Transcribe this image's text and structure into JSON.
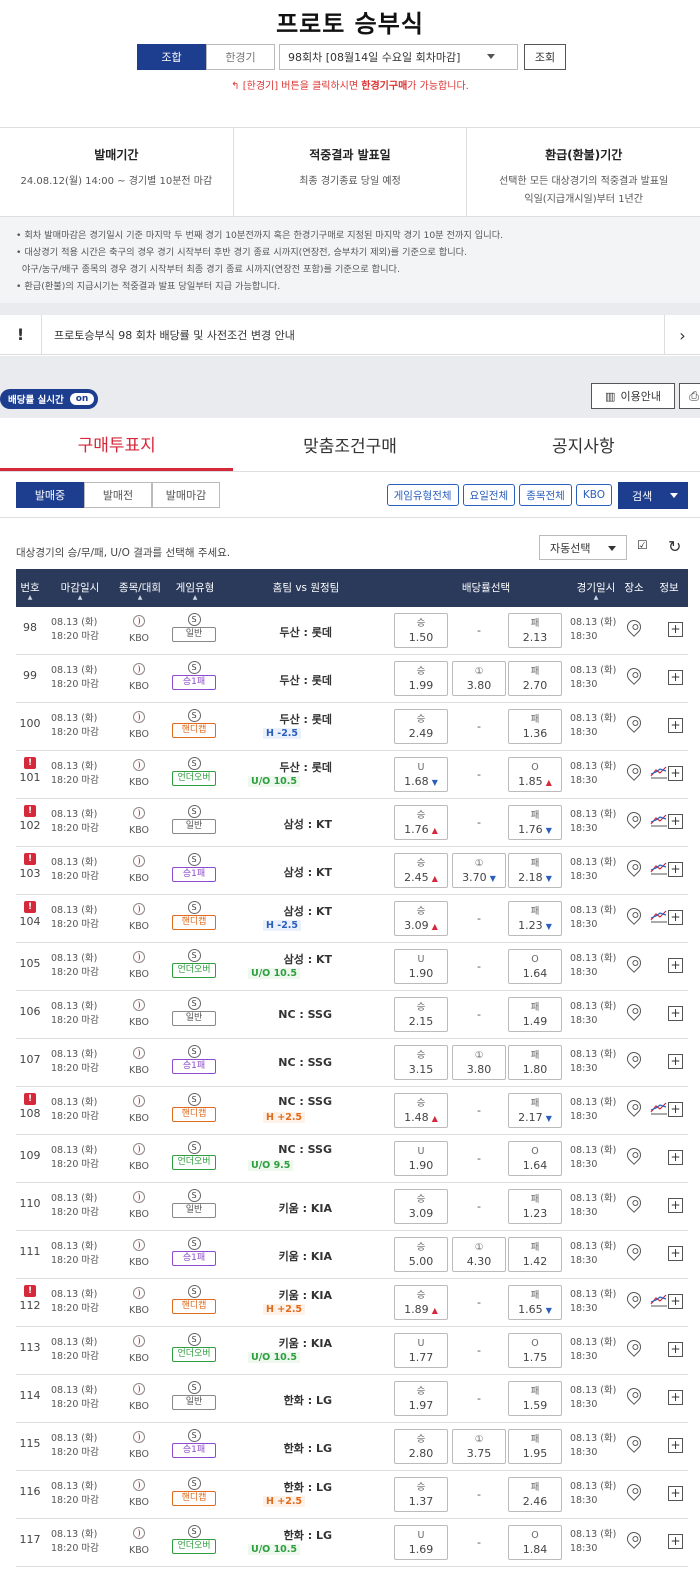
{
  "title": "프로토 승부식",
  "top": {
    "mode_tabs": [
      "조합",
      "한경기"
    ],
    "round_select": "98회차 [08월14일 수요일 회차마감]",
    "lookup_button": "조회",
    "notice_prefix": "↰ [한경기] 버튼을 클릭하시면 ",
    "notice_bold": "한경기구매",
    "notice_suffix": "가 가능합니다."
  },
  "info": [
    {
      "heading": "발매기간",
      "lines": [
        "24.08.12(월) 14:00 ~ 경기별 10분전 마감"
      ]
    },
    {
      "heading": "적중결과 발표일",
      "lines": [
        "최종 경기종료 당일 예정"
      ]
    },
    {
      "heading": "환급(환불)기간",
      "lines": [
        "선택한 모든 대상경기의 적중결과 발표일",
        "익일(지급개시일)부터 1년간"
      ]
    }
  ],
  "rules": [
    "• 회차 발매마감은 경기일시 기준 마지막 두 번째 경기 10분전까지 혹은 한경기구매로 지정된 마지막 경기 10분 전까지 입니다.",
    "• 대상경기 적용 시간은 축구의 경우 경기 시작부터 후반 경기 종료 시까지(연장전, 승부차기 제외)를 기준으로 합니다.",
    "  야구/농구/배구 종목의 경우 경기 시작부터 최종 경기 종료 시까지(연장전 포함)를 기준으로 합니다.",
    "• 환급(환불)의 지급시기는 적중결과 발표 당일부터 지급 가능합니다."
  ],
  "announce": {
    "mark": "!",
    "text": "프로토승부식 98 회차 배당률 및 사전조건 변경 안내",
    "chevron": "›"
  },
  "realtime": {
    "label": "배당률 실시간",
    "state": "on"
  },
  "guide_button": "이용안내",
  "print_icon": "printer-icon",
  "tabs": [
    "구매투표지",
    "맞춤조건구매",
    "공지사항"
  ],
  "filters": [
    "발매중",
    "발매전",
    "발매마감"
  ],
  "chips": [
    "게임유형전체",
    "요일전체",
    "종목전체",
    "KBO"
  ],
  "search_button": "검색",
  "hint": "대상경기의 승/무/패, U/O 결과를 선택해 주세요.",
  "auto_select": "자동선택",
  "columns": [
    "번호",
    "마감일시",
    "종목/대회",
    "게임유형",
    "홈팀 vs 원정팀",
    "배당률선택",
    "경기일시",
    "장소",
    "정보"
  ],
  "rows": [
    {
      "no": "98",
      "alert": false,
      "d1": "08.13 (화)",
      "d2": "18:20 마감",
      "league": "KBO",
      "type": "일반",
      "tc": "t0",
      "team": "두산 : 롯데",
      "hc": "",
      "hcc": "",
      "o1l": "승",
      "o1": "1.50",
      "o1t": "",
      "o2l": "",
      "o2": "",
      "o2t": "",
      "o3l": "패",
      "o3": "2.13",
      "o3t": "",
      "g1": "08.13 (화)",
      "g2": "18:30",
      "chart": false
    },
    {
      "no": "99",
      "alert": false,
      "d1": "08.13 (화)",
      "d2": "18:20 마감",
      "league": "KBO",
      "type": "승1패",
      "tc": "t1",
      "team": "두산 : 롯데",
      "hc": "",
      "hcc": "",
      "o1l": "승",
      "o1": "1.99",
      "o1t": "",
      "o2l": "①",
      "o2": "3.80",
      "o2t": "",
      "o3l": "패",
      "o3": "2.70",
      "o3t": "",
      "g1": "08.13 (화)",
      "g2": "18:30",
      "chart": false
    },
    {
      "no": "100",
      "alert": false,
      "d1": "08.13 (화)",
      "d2": "18:20 마감",
      "league": "KBO",
      "type": "핸디캡",
      "tc": "t2",
      "team": "두산 : 롯데",
      "hc": "H -2.5",
      "hcc": "minus",
      "o1l": "승",
      "o1": "2.49",
      "o1t": "",
      "o2l": "",
      "o2": "",
      "o2t": "",
      "o3l": "패",
      "o3": "1.36",
      "o3t": "",
      "g1": "08.13 (화)",
      "g2": "18:30",
      "chart": false
    },
    {
      "no": "101",
      "alert": true,
      "d1": "08.13 (화)",
      "d2": "18:20 마감",
      "league": "KBO",
      "type": "언더오버",
      "tc": "t3",
      "team": "두산 : 롯데",
      "hc": "U/O 10.5",
      "hcc": "uo",
      "o1l": "U",
      "o1": "1.68",
      "o1t": "dn",
      "o2l": "",
      "o2": "",
      "o2t": "",
      "o3l": "O",
      "o3": "1.85",
      "o3t": "up",
      "g1": "08.13 (화)",
      "g2": "18:30",
      "chart": true
    },
    {
      "no": "102",
      "alert": true,
      "d1": "08.13 (화)",
      "d2": "18:20 마감",
      "league": "KBO",
      "type": "일반",
      "tc": "t0",
      "team": "삼성 : KT",
      "hc": "",
      "hcc": "",
      "o1l": "승",
      "o1": "1.76",
      "o1t": "up",
      "o2l": "",
      "o2": "",
      "o2t": "",
      "o3l": "패",
      "o3": "1.76",
      "o3t": "dn",
      "g1": "08.13 (화)",
      "g2": "18:30",
      "chart": true
    },
    {
      "no": "103",
      "alert": true,
      "d1": "08.13 (화)",
      "d2": "18:20 마감",
      "league": "KBO",
      "type": "승1패",
      "tc": "t1",
      "team": "삼성 : KT",
      "hc": "",
      "hcc": "",
      "o1l": "승",
      "o1": "2.45",
      "o1t": "up",
      "o2l": "①",
      "o2": "3.70",
      "o2t": "dn",
      "o3l": "패",
      "o3": "2.18",
      "o3t": "dn",
      "g1": "08.13 (화)",
      "g2": "18:30",
      "chart": true
    },
    {
      "no": "104",
      "alert": true,
      "d1": "08.13 (화)",
      "d2": "18:20 마감",
      "league": "KBO",
      "type": "핸디캡",
      "tc": "t2",
      "team": "삼성 : KT",
      "hc": "H -2.5",
      "hcc": "minus",
      "o1l": "승",
      "o1": "3.09",
      "o1t": "up",
      "o2l": "",
      "o2": "",
      "o2t": "",
      "o3l": "패",
      "o3": "1.23",
      "o3t": "dn",
      "g1": "08.13 (화)",
      "g2": "18:30",
      "chart": true
    },
    {
      "no": "105",
      "alert": false,
      "d1": "08.13 (화)",
      "d2": "18:20 마감",
      "league": "KBO",
      "type": "언더오버",
      "tc": "t3",
      "team": "삼성 : KT",
      "hc": "U/O 10.5",
      "hcc": "uo",
      "o1l": "U",
      "o1": "1.90",
      "o1t": "",
      "o2l": "",
      "o2": "",
      "o2t": "",
      "o3l": "O",
      "o3": "1.64",
      "o3t": "",
      "g1": "08.13 (화)",
      "g2": "18:30",
      "chart": false
    },
    {
      "no": "106",
      "alert": false,
      "d1": "08.13 (화)",
      "d2": "18:20 마감",
      "league": "KBO",
      "type": "일반",
      "tc": "t0",
      "team": "NC : SSG",
      "hc": "",
      "hcc": "",
      "o1l": "승",
      "o1": "2.15",
      "o1t": "",
      "o2l": "",
      "o2": "",
      "o2t": "",
      "o3l": "패",
      "o3": "1.49",
      "o3t": "",
      "g1": "08.13 (화)",
      "g2": "18:30",
      "chart": false
    },
    {
      "no": "107",
      "alert": false,
      "d1": "08.13 (화)",
      "d2": "18:20 마감",
      "league": "KBO",
      "type": "승1패",
      "tc": "t1",
      "team": "NC : SSG",
      "hc": "",
      "hcc": "",
      "o1l": "승",
      "o1": "3.15",
      "o1t": "",
      "o2l": "①",
      "o2": "3.80",
      "o2t": "",
      "o3l": "패",
      "o3": "1.80",
      "o3t": "",
      "g1": "08.13 (화)",
      "g2": "18:30",
      "chart": false
    },
    {
      "no": "108",
      "alert": true,
      "d1": "08.13 (화)",
      "d2": "18:20 마감",
      "league": "KBO",
      "type": "핸디캡",
      "tc": "t2",
      "team": "NC : SSG",
      "hc": "H +2.5",
      "hcc": "plus",
      "o1l": "승",
      "o1": "1.48",
      "o1t": "up",
      "o2l": "",
      "o2": "",
      "o2t": "",
      "o3l": "패",
      "o3": "2.17",
      "o3t": "dn",
      "g1": "08.13 (화)",
      "g2": "18:30",
      "chart": true
    },
    {
      "no": "109",
      "alert": false,
      "d1": "08.13 (화)",
      "d2": "18:20 마감",
      "league": "KBO",
      "type": "언더오버",
      "tc": "t3",
      "team": "NC : SSG",
      "hc": "U/O 9.5",
      "hcc": "uo",
      "o1l": "U",
      "o1": "1.90",
      "o1t": "",
      "o2l": "",
      "o2": "",
      "o2t": "",
      "o3l": "O",
      "o3": "1.64",
      "o3t": "",
      "g1": "08.13 (화)",
      "g2": "18:30",
      "chart": false
    },
    {
      "no": "110",
      "alert": false,
      "d1": "08.13 (화)",
      "d2": "18:20 마감",
      "league": "KBO",
      "type": "일반",
      "tc": "t0",
      "team": "키움 : KIA",
      "hc": "",
      "hcc": "",
      "o1l": "승",
      "o1": "3.09",
      "o1t": "",
      "o2l": "",
      "o2": "",
      "o2t": "",
      "o3l": "패",
      "o3": "1.23",
      "o3t": "",
      "g1": "08.13 (화)",
      "g2": "18:30",
      "chart": false
    },
    {
      "no": "111",
      "alert": false,
      "d1": "08.13 (화)",
      "d2": "18:20 마감",
      "league": "KBO",
      "type": "승1패",
      "tc": "t1",
      "team": "키움 : KIA",
      "hc": "",
      "hcc": "",
      "o1l": "승",
      "o1": "5.00",
      "o1t": "",
      "o2l": "①",
      "o2": "4.30",
      "o2t": "",
      "o3l": "패",
      "o3": "1.42",
      "o3t": "",
      "g1": "08.13 (화)",
      "g2": "18:30",
      "chart": false
    },
    {
      "no": "112",
      "alert": true,
      "d1": "08.13 (화)",
      "d2": "18:20 마감",
      "league": "KBO",
      "type": "핸디캡",
      "tc": "t2",
      "team": "키움 : KIA",
      "hc": "H +2.5",
      "hcc": "plus",
      "o1l": "승",
      "o1": "1.89",
      "o1t": "up",
      "o2l": "",
      "o2": "",
      "o2t": "",
      "o3l": "패",
      "o3": "1.65",
      "o3t": "dn",
      "g1": "08.13 (화)",
      "g2": "18:30",
      "chart": true
    },
    {
      "no": "113",
      "alert": false,
      "d1": "08.13 (화)",
      "d2": "18:20 마감",
      "league": "KBO",
      "type": "언더오버",
      "tc": "t3",
      "team": "키움 : KIA",
      "hc": "U/O 10.5",
      "hcc": "uo",
      "o1l": "U",
      "o1": "1.77",
      "o1t": "",
      "o2l": "",
      "o2": "",
      "o2t": "",
      "o3l": "O",
      "o3": "1.75",
      "o3t": "",
      "g1": "08.13 (화)",
      "g2": "18:30",
      "chart": false
    },
    {
      "no": "114",
      "alert": false,
      "d1": "08.13 (화)",
      "d2": "18:20 마감",
      "league": "KBO",
      "type": "일반",
      "tc": "t0",
      "team": "한화 : LG",
      "hc": "",
      "hcc": "",
      "o1l": "승",
      "o1": "1.97",
      "o1t": "",
      "o2l": "",
      "o2": "",
      "o2t": "",
      "o3l": "패",
      "o3": "1.59",
      "o3t": "",
      "g1": "08.13 (화)",
      "g2": "18:30",
      "chart": false
    },
    {
      "no": "115",
      "alert": false,
      "d1": "08.13 (화)",
      "d2": "18:20 마감",
      "league": "KBO",
      "type": "승1패",
      "tc": "t1",
      "team": "한화 : LG",
      "hc": "",
      "hcc": "",
      "o1l": "승",
      "o1": "2.80",
      "o1t": "",
      "o2l": "①",
      "o2": "3.75",
      "o2t": "",
      "o3l": "패",
      "o3": "1.95",
      "o3t": "",
      "g1": "08.13 (화)",
      "g2": "18:30",
      "chart": false
    },
    {
      "no": "116",
      "alert": false,
      "d1": "08.13 (화)",
      "d2": "18:20 마감",
      "league": "KBO",
      "type": "핸디캡",
      "tc": "t2",
      "team": "한화 : LG",
      "hc": "H +2.5",
      "hcc": "plus",
      "o1l": "승",
      "o1": "1.37",
      "o1t": "",
      "o2l": "",
      "o2": "",
      "o2t": "",
      "o3l": "패",
      "o3": "2.46",
      "o3t": "",
      "g1": "08.13 (화)",
      "g2": "18:30",
      "chart": false
    },
    {
      "no": "117",
      "alert": false,
      "d1": "08.13 (화)",
      "d2": "18:20 마감",
      "league": "KBO",
      "type": "언더오버",
      "tc": "t3",
      "team": "한화 : LG",
      "hc": "U/O 10.5",
      "hcc": "uo",
      "o1l": "U",
      "o1": "1.69",
      "o1t": "",
      "o2l": "",
      "o2": "",
      "o2t": "",
      "o3l": "O",
      "o3": "1.84",
      "o3t": "",
      "g1": "08.13 (화)",
      "g2": "18:30",
      "chart": false
    }
  ]
}
